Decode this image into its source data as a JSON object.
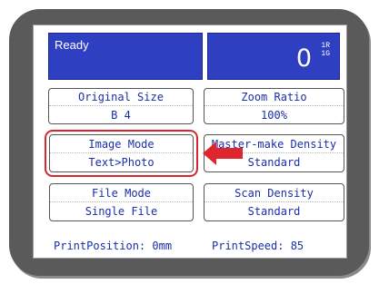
{
  "status": {
    "text": "Ready"
  },
  "counter": {
    "value": "0",
    "unit_top": "1R",
    "unit_bottom": "1G"
  },
  "buttons": {
    "original_size": {
      "label": "Original Size",
      "value": "B 4"
    },
    "zoom_ratio": {
      "label": "Zoom Ratio",
      "value": "100%"
    },
    "image_mode": {
      "label": "Image Mode",
      "value": "Text>Photo"
    },
    "master_make_density": {
      "label": "Master-make Density",
      "value": "Standard"
    },
    "file_mode": {
      "label": "File Mode",
      "value": "Single File"
    },
    "scan_density": {
      "label": "Scan Density",
      "value": "Standard"
    }
  },
  "footer": {
    "print_position": "PrintPosition: 0mm",
    "print_speed": "PrintSpeed: 85"
  },
  "colors": {
    "panel_blue": "#2f3fc2",
    "text_blue": "#1a2ea8",
    "highlight_red": "#d8262e",
    "bezel": "#5a5a5a"
  },
  "annotation": {
    "highlighted_button": "image_mode",
    "arrow_icon": "red-left-arrow-icon"
  }
}
